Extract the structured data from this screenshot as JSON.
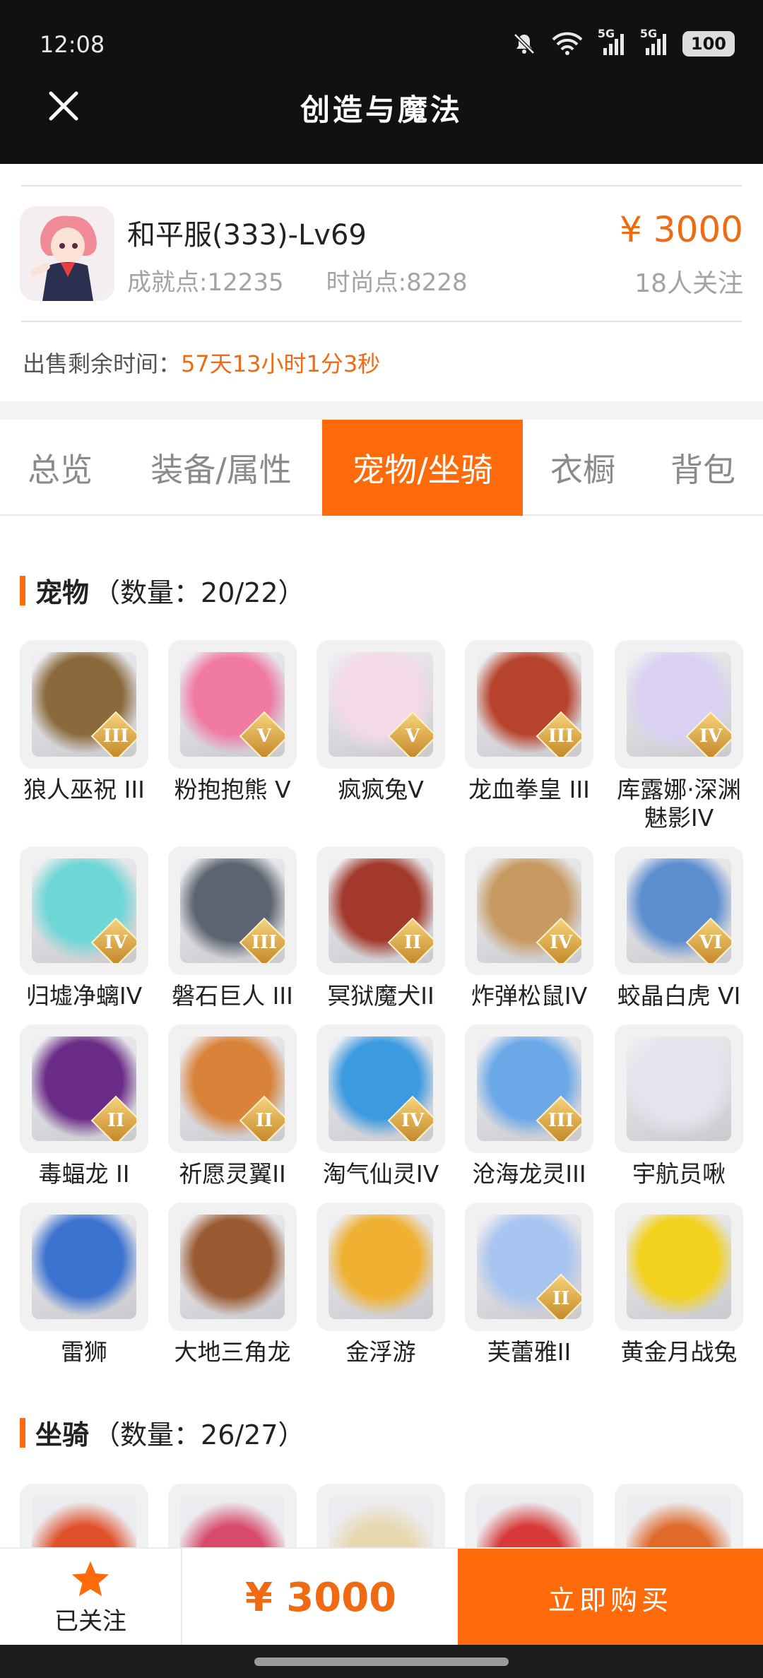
{
  "status_bar": {
    "time": "12:08",
    "icons": [
      "mute-icon",
      "wifi-icon",
      "signal-5g-icon",
      "signal-5g-icon",
      "battery-icon"
    ],
    "network_label": "5G",
    "battery": "100"
  },
  "header": {
    "close_icon": "close-icon",
    "title": "创造与魔法"
  },
  "account": {
    "name": "和平服(333)-Lv69",
    "achievement": "成就点:12235",
    "fashion": "时尚点:8228",
    "price": "¥ 3000",
    "followers": "18人关注",
    "remaining_label": "出售剩余时间：",
    "remaining_value": "57天13小时1分3秒"
  },
  "tabs": [
    "总览",
    "装备/属性",
    "宠物/坐骑",
    "衣橱",
    "背包"
  ],
  "active_tab": 2,
  "pets_section": {
    "title": "宠物",
    "count": "（数量：20/22）",
    "items": [
      {
        "name": "狼人巫祝 III",
        "tier": "III",
        "color": "#8a6a3c"
      },
      {
        "name": "粉抱抱熊 V",
        "tier": "V",
        "color": "#f07aa4"
      },
      {
        "name": "疯疯兔V",
        "tier": "V",
        "color": "#f4d9e8"
      },
      {
        "name": "龙血拳皇 III",
        "tier": "III",
        "color": "#b8432c"
      },
      {
        "name": "库露娜·深渊魅影IV",
        "tier": "IV",
        "color": "#d9d0f2"
      },
      {
        "name": "归墟净螭IV",
        "tier": "IV",
        "color": "#6fd6d6"
      },
      {
        "name": "磐石巨人 III",
        "tier": "III",
        "color": "#5b6470"
      },
      {
        "name": "冥狱魔犬II",
        "tier": "II",
        "color": "#a2392c"
      },
      {
        "name": "炸弹松鼠IV",
        "tier": "IV",
        "color": "#c79a62"
      },
      {
        "name": "蛟晶白虎 VI",
        "tier": "VI",
        "color": "#5d8ed0"
      },
      {
        "name": "毒蝠龙 II",
        "tier": "II",
        "color": "#6a2c86"
      },
      {
        "name": "祈愿灵翼II",
        "tier": "II",
        "color": "#d8823a"
      },
      {
        "name": "淘气仙灵IV",
        "tier": "IV",
        "color": "#3c9ae0"
      },
      {
        "name": "沧海龙灵III",
        "tier": "III",
        "color": "#6aa8e8"
      },
      {
        "name": "宇航员啾",
        "tier": "",
        "color": "#e4e4ee"
      },
      {
        "name": "雷狮",
        "tier": "",
        "color": "#3c72d0"
      },
      {
        "name": "大地三角龙",
        "tier": "",
        "color": "#9a5a32"
      },
      {
        "name": "金浮游",
        "tier": "",
        "color": "#f0b032"
      },
      {
        "name": "芙蕾雅II",
        "tier": "II",
        "color": "#a8c4f0"
      },
      {
        "name": "黄金月战兔",
        "tier": "",
        "color": "#f2d21c"
      }
    ]
  },
  "mounts_section": {
    "title": "坐骑",
    "count": "（数量：26/27）",
    "items": [
      {
        "color": "#e0502a"
      },
      {
        "color": "#d84a6a"
      },
      {
        "color": "#e8d8b0"
      },
      {
        "color": "#d83a3a"
      },
      {
        "color": "#e06a2a"
      }
    ]
  },
  "bottom_bar": {
    "follow_label": "已关注",
    "star_icon": "star-icon",
    "total_price": "¥ 3000",
    "buy_label": "立即购买"
  },
  "colors": {
    "accent": "#ff6a0a",
    "price": "#ef6a12",
    "header_bg": "#111111"
  }
}
